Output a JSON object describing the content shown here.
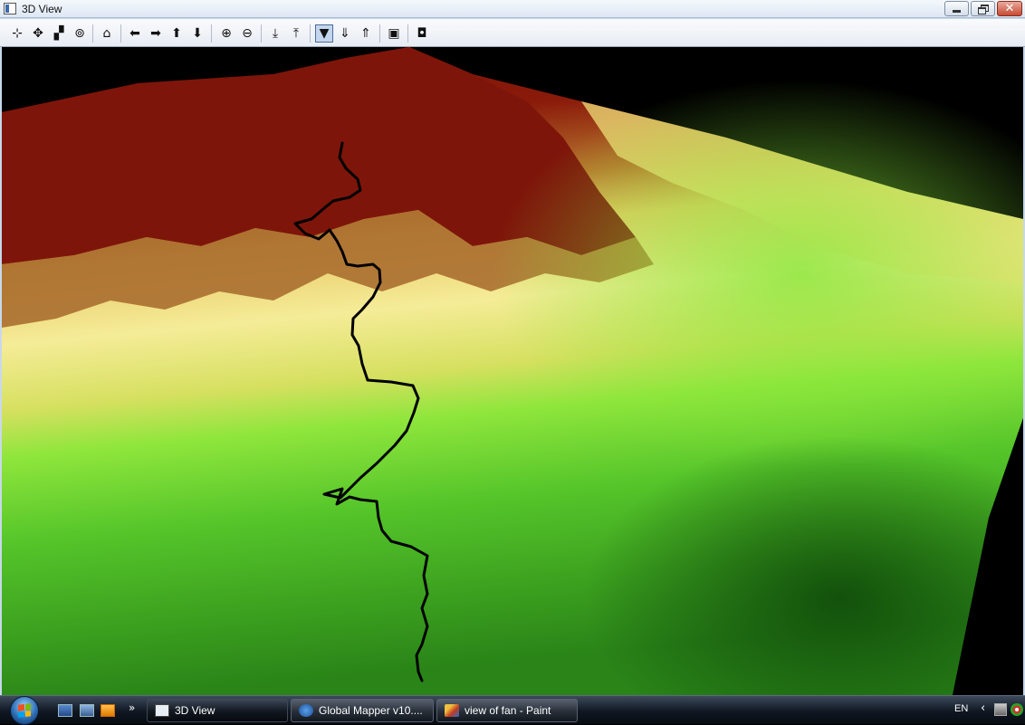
{
  "window": {
    "title": "3D View",
    "controls": {
      "minimize": "minimize-icon",
      "restore": "restore-icon",
      "close": "close-icon"
    }
  },
  "toolbar": {
    "tools": [
      {
        "name": "digitizer-icon",
        "glyph": "⊹"
      },
      {
        "name": "pan-icon",
        "glyph": "✥"
      },
      {
        "name": "zoom-box-icon",
        "glyph": "▞"
      },
      {
        "name": "binoculars-icon",
        "glyph": "⊚"
      },
      {
        "name": "home-icon",
        "glyph": "⌂"
      },
      {
        "name": "arrow-left-icon",
        "glyph": "⬅"
      },
      {
        "name": "arrow-right-icon",
        "glyph": "➡"
      },
      {
        "name": "arrow-up-icon",
        "glyph": "⬆"
      },
      {
        "name": "arrow-down-icon",
        "glyph": "⬇"
      },
      {
        "name": "zoom-in-icon",
        "glyph": "⊕"
      },
      {
        "name": "zoom-out-icon",
        "glyph": "⊖"
      },
      {
        "name": "lower-terrain-icon",
        "glyph": "⤓"
      },
      {
        "name": "raise-terrain-icon",
        "glyph": "⤒"
      },
      {
        "name": "water-level-icon",
        "glyph": "▼"
      },
      {
        "name": "vertical-exaggeration-down-icon",
        "glyph": "⇓"
      },
      {
        "name": "vertical-exaggeration-up-icon",
        "glyph": "⇑"
      },
      {
        "name": "save-icon",
        "glyph": "▣"
      },
      {
        "name": "camera-icon",
        "glyph": "◘"
      }
    ]
  },
  "viewport": {
    "content": "3D terrain rendering",
    "colors": {
      "sky": "#000000",
      "peak": "#7a1408",
      "high": "#c8893a",
      "mid": "#f2e88a",
      "low": "#86e83a",
      "valley": "#1f7a12"
    }
  },
  "taskbar": {
    "tasks": [
      {
        "label": "3D View",
        "icon": "window-icon",
        "active": true
      },
      {
        "label": "Global Mapper v10....",
        "icon": "globe-icon",
        "active": false
      },
      {
        "label": "view of fan - Paint",
        "icon": "paint-icon",
        "active": false
      }
    ],
    "language": "EN",
    "more_glyph": "»",
    "tray_arrow": "‹"
  }
}
